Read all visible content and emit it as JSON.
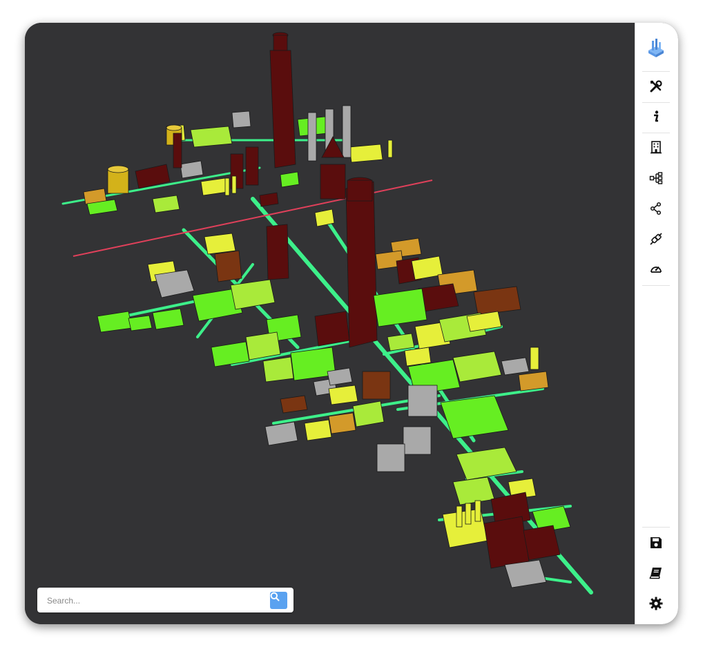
{
  "search": {
    "placeholder": "Search..."
  },
  "sidebar": {
    "items": [
      {
        "id": "logo",
        "icon": "city-logo-icon"
      },
      {
        "id": "tools",
        "icon": "tools-icon"
      },
      {
        "id": "info",
        "icon": "info-icon"
      },
      {
        "id": "building",
        "icon": "building-icon"
      },
      {
        "id": "hierarchy",
        "icon": "hierarchy-icon"
      },
      {
        "id": "share",
        "icon": "share-nodes-icon"
      },
      {
        "id": "connection",
        "icon": "plug-connection-icon"
      },
      {
        "id": "dashboard",
        "icon": "gauge-icon"
      },
      {
        "id": "save",
        "icon": "save-icon"
      },
      {
        "id": "book",
        "icon": "book-icon"
      },
      {
        "id": "settings",
        "icon": "gear-icon"
      }
    ]
  },
  "colors": {
    "background": "#333335",
    "street": "#3df08a",
    "building_green": "#66ee22",
    "building_lightgreen": "#a9ea3a",
    "building_yellow": "#e6ef3a",
    "building_orange": "#d39a2a",
    "building_brown": "#7a3512",
    "building_darkred": "#5a0d0d",
    "building_gray": "#a9a9a9",
    "selection_line": "#e0405a",
    "accent": "#5aa2f0"
  }
}
